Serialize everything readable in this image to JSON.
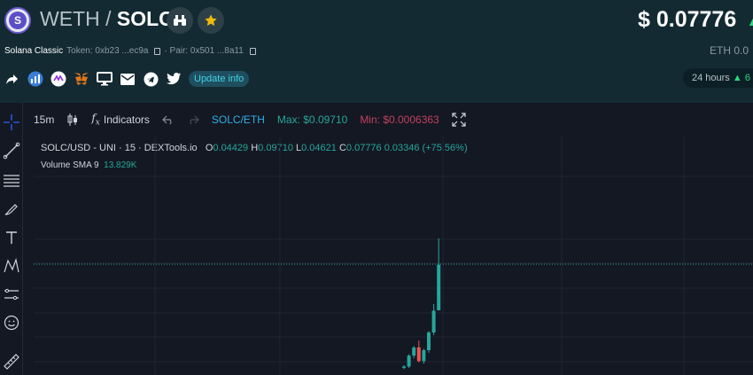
{
  "header": {
    "quote": "WETH",
    "slash": "/",
    "base": "SOLC",
    "price": "$ 0.07776",
    "eth_label": "ETH 0.0",
    "token_name": "Solana Classic",
    "token_addr": "Token: 0xb23 ...ec9a",
    "pair_addr": "· Pair: 0x501 ...8a11",
    "update_label": "Update info",
    "range_label": "24 hours",
    "range_value": "6",
    "icons": [
      "share-icon",
      "chart-icon",
      "swap-icon",
      "metamask-icon",
      "monitor-icon",
      "mail-icon",
      "telegram-icon",
      "twitter-icon"
    ]
  },
  "toolbar": {
    "interval": "15m",
    "indicators_label": "Indicators",
    "pair_link": "SOLC/ETH",
    "max_label": "Max: $0.09710",
    "min_label": "Min: $0.0006363"
  },
  "legend": {
    "series": "SOLC/USD - UNI · 15 · DEXTools.io",
    "o_label": "O",
    "o_val": "0.04429",
    "h_label": "H",
    "h_val": "0.09710",
    "l_label": "L",
    "l_val": "0.04621",
    "c_label": "C",
    "c_val": "0.07776",
    "change": "0.03346 (+75.56%)",
    "volume_label": "Volume SMA 9",
    "volume_val": "13.829K"
  },
  "colors": {
    "up": "#26a69a",
    "down": "#ef5350",
    "accent": "#2eb1e6",
    "star": "#f0b90b"
  },
  "chart_data": {
    "type": "candlestick",
    "interval": "15m",
    "candles": [
      {
        "o": 0.002,
        "h": 0.004,
        "l": 0.001,
        "c": 0.003
      },
      {
        "o": 0.003,
        "h": 0.012,
        "l": 0.002,
        "c": 0.011
      },
      {
        "o": 0.011,
        "h": 0.018,
        "l": 0.009,
        "c": 0.017
      },
      {
        "o": 0.017,
        "h": 0.022,
        "l": 0.006,
        "c": 0.007
      },
      {
        "o": 0.007,
        "h": 0.016,
        "l": 0.005,
        "c": 0.015
      },
      {
        "o": 0.015,
        "h": 0.029,
        "l": 0.013,
        "c": 0.028
      },
      {
        "o": 0.028,
        "h": 0.049,
        "l": 0.026,
        "c": 0.044
      },
      {
        "o": 0.04429,
        "h": 0.0971,
        "l": 0.04621,
        "c": 0.07776
      }
    ]
  }
}
